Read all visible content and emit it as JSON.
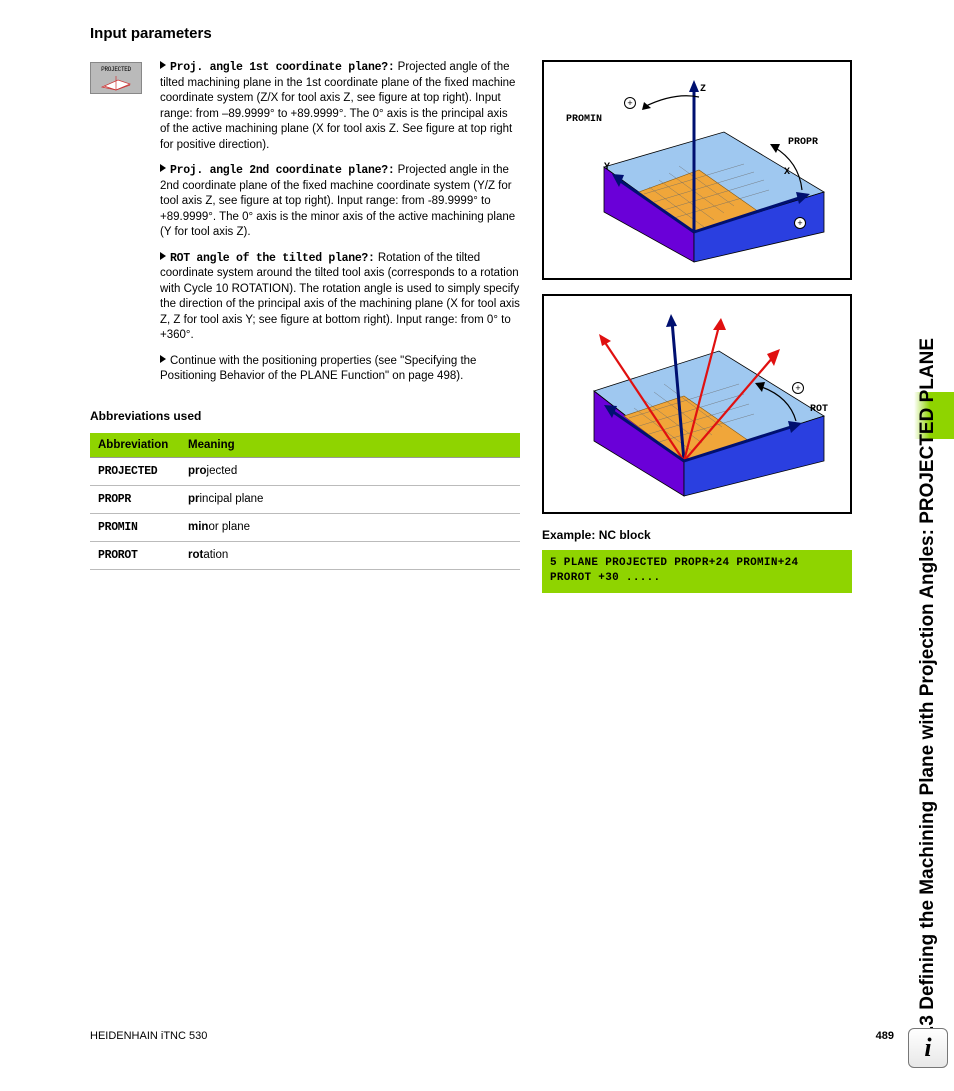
{
  "heading": "Input parameters",
  "iconLabel": "PROJECTED",
  "params": [
    {
      "label": "Proj. angle 1st coordinate plane?:",
      "text": " Projected angle of the tilted machining plane in the 1st coordinate plane of the fixed machine coordinate system (Z/X for tool axis Z, see figure at top right). Input range: from –89.9999° to +89.9999°. The 0° axis is the principal axis of the active machining plane (X for tool axis Z. See figure at top right for positive direction)."
    },
    {
      "label": "Proj. angle 2nd coordinate plane?:",
      "text": " Projected angle in the 2nd coordinate plane of the fixed machine coordinate system (Y/Z for tool axis Z, see figure at top right). Input range: from -89.9999° to +89.9999°. The 0° axis is the minor axis of the active machining plane (Y for tool axis Z)."
    },
    {
      "label": "ROT angle of the tilted plane?:",
      "text": " Rotation of the tilted coordinate system around the tilted tool axis (corresponds to a rotation with Cycle 10 ROTATION). The rotation angle is used to simply specify the direction of the principal axis of the machining plane (X for tool axis Z, Z for tool axis Y; see figure at bottom right). Input range: from 0° to +360°."
    },
    {
      "label": "",
      "text": "Continue with the positioning properties (see \"Specifying the Positioning Behavior of the PLANE Function\" on page 498)."
    }
  ],
  "abbrHeading": "Abbreviations used",
  "tableHeaders": {
    "c1": "Abbreviation",
    "c2": "Meaning"
  },
  "rows": [
    {
      "abbr": "PROJECTED",
      "bold": "pro",
      "rest": "jected"
    },
    {
      "abbr": "PROPR",
      "bold": "pr",
      "rest": "incipal plane"
    },
    {
      "abbr": "PROMIN",
      "bold": "min",
      "rest": "or plane"
    },
    {
      "abbr": "PROROT",
      "bold": "rot",
      "rest": "ation"
    }
  ],
  "exampleHeading": "Example: NC block",
  "nc": "5 PLANE PROJECTED PROPR+24 PROMIN+24 PROROT +30 .....",
  "sideTitle": "9.3 Defining the Machining Plane with Projection Angles: PROJECTED PLANE",
  "footerLeft": "HEIDENHAIN iTNC 530",
  "pageNum": "489",
  "fig1": {
    "promin": "PROMIN",
    "propr": "PROPR",
    "x": "X",
    "y": "Y",
    "z": "Z"
  },
  "fig2": {
    "rot": "ROT"
  }
}
